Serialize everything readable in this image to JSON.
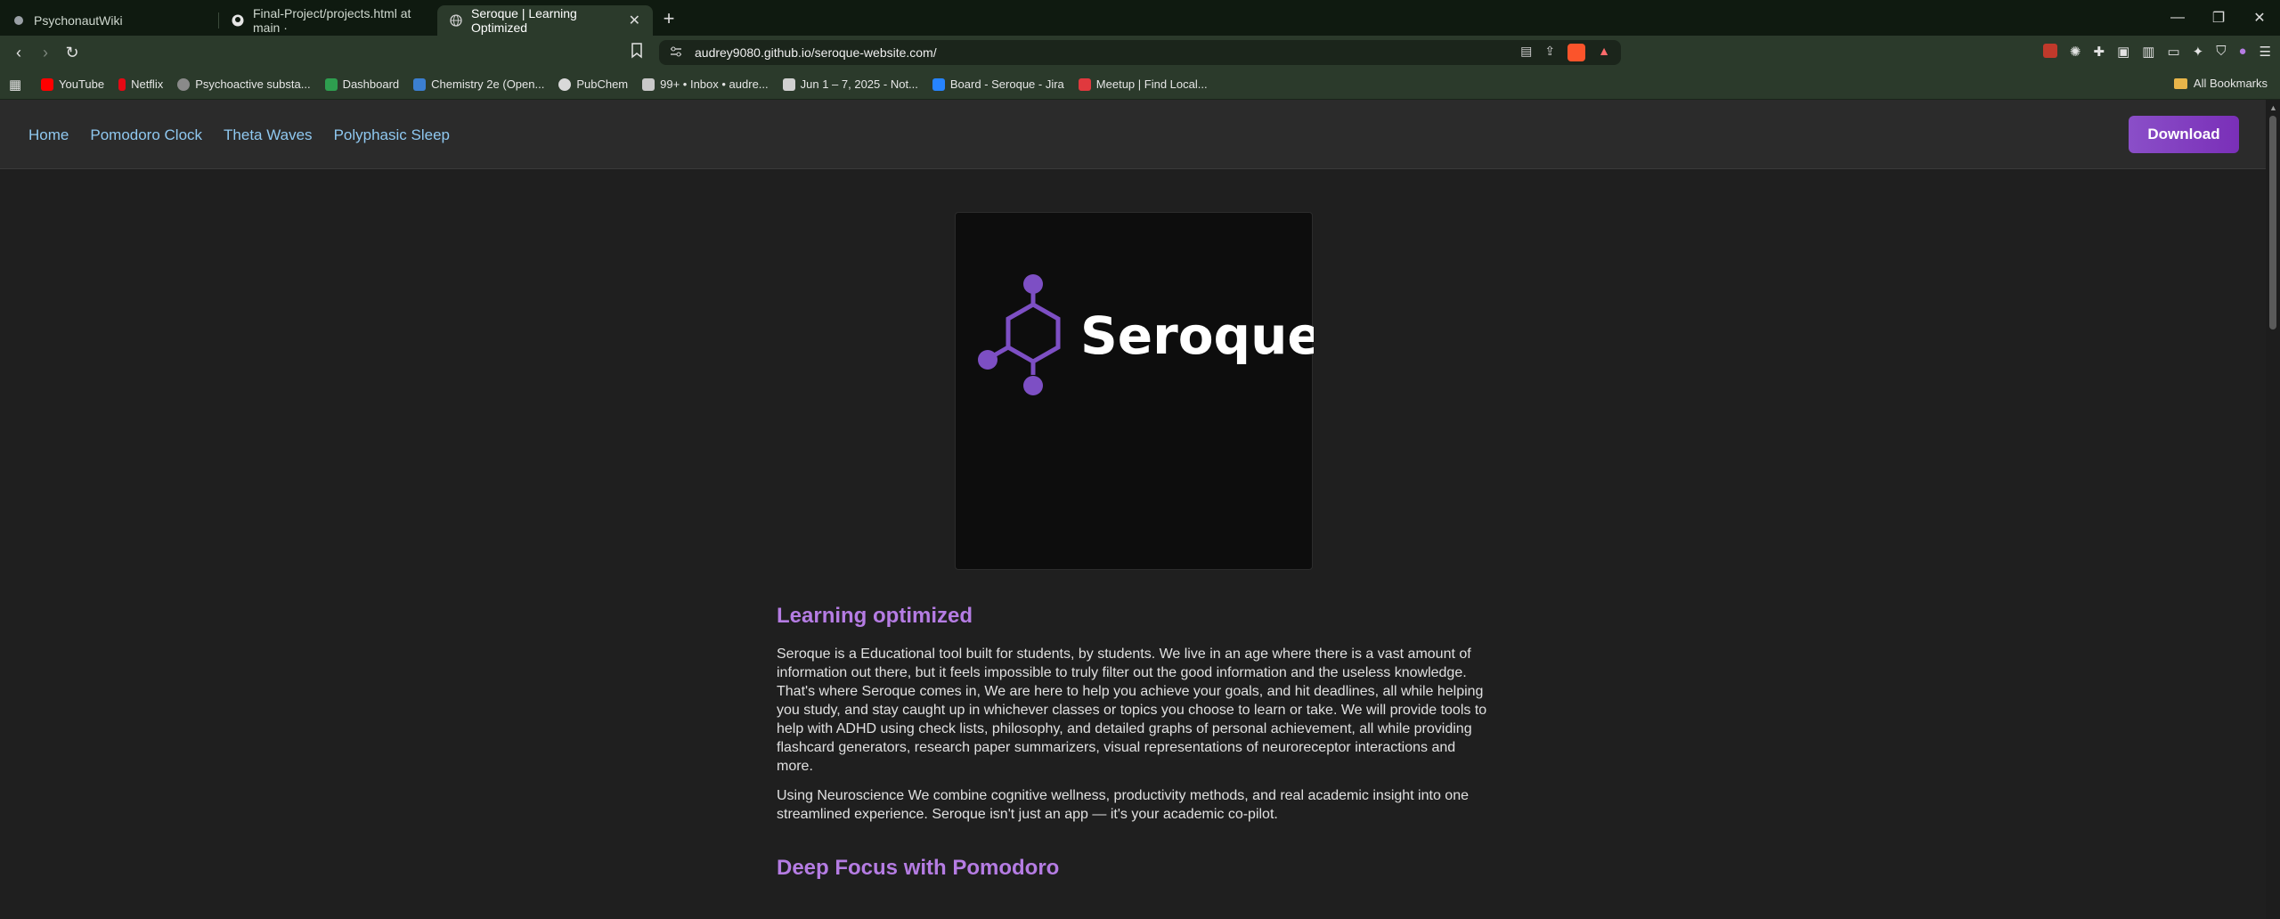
{
  "browser": {
    "tabs": [
      {
        "title": "PsychonautWiki",
        "icon": "psychonautwiki-icon"
      },
      {
        "title": "Final-Project/projects.html at main ·",
        "icon": "github-icon"
      },
      {
        "title": "Seroque | Learning Optimized",
        "icon": "globe-icon",
        "active": true
      }
    ],
    "new_tab": "+",
    "window_controls": {
      "minimize": "—",
      "restore": "❐",
      "close": "✕"
    },
    "nav": {
      "back": "‹",
      "forward": "›",
      "reload": "↻"
    },
    "url": "audrey9080.github.io/seroque-website.com/",
    "bookmarks": [
      {
        "label": "YouTube",
        "color": "#ff0000"
      },
      {
        "label": "Netflix",
        "color": "#e50914"
      },
      {
        "label": "Psychoactive substa...",
        "color": "#8a8a8a"
      },
      {
        "label": "Dashboard",
        "color": "#2e9e4f"
      },
      {
        "label": "Chemistry 2e (Open...",
        "color": "#3b7fd1"
      },
      {
        "label": "PubChem",
        "color": "#d9d9d9"
      },
      {
        "label": "99+ • Inbox • audre...",
        "color": "#c8c8c8"
      },
      {
        "label": "Jun 1 – 7, 2025 - Not...",
        "color": "#d0d0d0"
      },
      {
        "label": "Board - Seroque - Jira",
        "color": "#2684ff"
      },
      {
        "label": "Meetup | Find Local...",
        "color": "#e0393e"
      }
    ],
    "all_bookmarks": "All Bookmarks"
  },
  "site": {
    "nav": [
      "Home",
      "Pomodoro Clock",
      "Theta Waves",
      "Polyphasic Sleep"
    ],
    "download": "Download",
    "logo_text": "Seroque",
    "section1_title": "Learning optimized",
    "para1": "Seroque is a Educational tool built for students, by students. We live in an age where there is a vast amount of information out there, but it feels impossible to truly filter out the good information and the useless knowledge. That's where Seroque comes in, We are here to help you achieve your goals, and hit deadlines, all while helping you study, and stay caught up in whichever classes or topics you choose to learn or take. We will provide tools to help with ADHD using check lists, philosophy, and detailed graphs of personal achievement, all while providing flashcard generators, research paper summarizers, visual representations of neuroreceptor interactions and more.",
    "para2": "Using Neuroscience We combine cognitive wellness, productivity methods, and real academic insight into one streamlined experience. Seroque isn't just an app — it's your academic co-pilot.",
    "section2_title": "Deep Focus with Pomodoro"
  },
  "colors": {
    "accent": "#b57ce3",
    "logo_purple": "#7d4fc4",
    "link": "#8fc8f0"
  }
}
